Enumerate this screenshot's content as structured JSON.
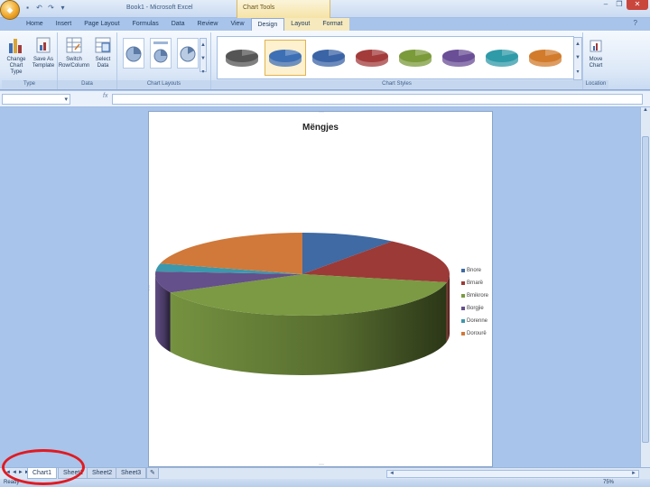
{
  "window": {
    "title": "Book1 - Microsoft Excel",
    "context_tab_group": "Chart Tools",
    "minimize": "–",
    "restore": "❐",
    "close": "✕"
  },
  "tabs": [
    "Home",
    "Insert",
    "Page Layout",
    "Formulas",
    "Data",
    "Review",
    "View",
    "Design",
    "Layout",
    "Format"
  ],
  "active_tab": "Design",
  "ribbon": {
    "type_group": {
      "label": "Type",
      "change_chart_type": "Change Chart Type",
      "save_as_template": "Save As Template"
    },
    "data_group": {
      "label": "Data",
      "switch_row_column": "Switch Row/Column",
      "select_data": "Select Data"
    },
    "chart_layouts_group": {
      "label": "Chart Layouts"
    },
    "chart_styles_group": {
      "label": "Chart Styles",
      "style_colors": [
        "#555555",
        "#3d6fb5",
        "#3b64a6",
        "#a33b3b",
        "#7b9a3a",
        "#6a4e96",
        "#2f9aa8",
        "#d27b2c"
      ],
      "selected_index": 1
    },
    "location_group": {
      "label": "Location",
      "move_chart": "Move Chart"
    }
  },
  "formula_bar": {
    "fx_label": "fx",
    "name_box_value": "",
    "formula_value": ""
  },
  "chart_data": {
    "type": "pie",
    "style": "3d",
    "title": "Mëngjes",
    "categories": [
      "Bnore",
      "Brnarë",
      "Bmikrore",
      "Borgjie",
      "Dorenne",
      "Dorourë"
    ],
    "values": [
      10,
      17,
      38,
      8,
      3,
      20
    ],
    "colors": [
      "#3f6aa3",
      "#9c3a37",
      "#7b9a43",
      "#64508a",
      "#3c98ac",
      "#d0793a"
    ],
    "legend_position": "right"
  },
  "sheets": {
    "tabs": [
      "Chart1",
      "Sheet1",
      "Sheet2",
      "Sheet3"
    ],
    "active": "Chart1",
    "nav_arrows": "◄ ◄ ► ►"
  },
  "status": {
    "text": "Ready",
    "zoom": "75%"
  },
  "annotation": {
    "color": "#e01b22"
  }
}
